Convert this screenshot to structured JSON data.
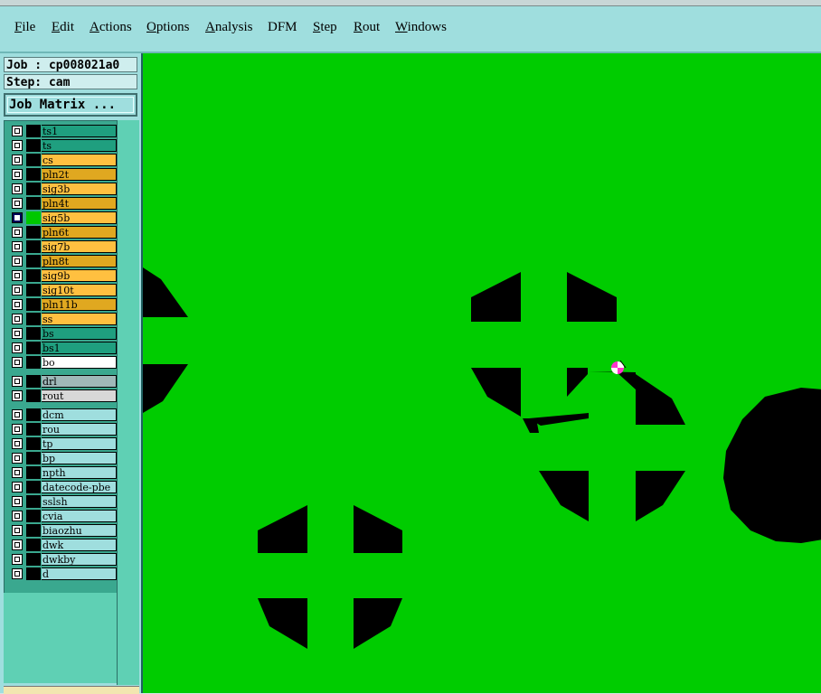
{
  "menu": [
    {
      "pre": "",
      "u": "F",
      "post": "ile"
    },
    {
      "pre": "",
      "u": "E",
      "post": "dit"
    },
    {
      "pre": "",
      "u": "A",
      "post": "ctions"
    },
    {
      "pre": "",
      "u": "O",
      "post": "ptions"
    },
    {
      "pre": "",
      "u": "A",
      "post": "nalysis"
    },
    {
      "pre": "DFM",
      "u": "",
      "post": ""
    },
    {
      "pre": "",
      "u": "S",
      "post": "tep"
    },
    {
      "pre": "",
      "u": "R",
      "post": "out"
    },
    {
      "pre": "",
      "u": "W",
      "post": "indows"
    }
  ],
  "info": {
    "job": "Job : cp008021a0",
    "step": "Step: cam",
    "job_matrix": "Job Matrix ..."
  },
  "layers": [
    {
      "name": "ts1",
      "color": "#1f9f7f"
    },
    {
      "name": "ts",
      "color": "#1f9f7f"
    },
    {
      "name": "cs",
      "color": "#ffc040"
    },
    {
      "name": "pln2t",
      "color": "#e0a820"
    },
    {
      "name": "sig3b",
      "color": "#ffc040"
    },
    {
      "name": "pln4t",
      "color": "#e0a820"
    },
    {
      "name": "sig5b",
      "color": "#ffc040",
      "active": true
    },
    {
      "name": "pln6t",
      "color": "#e0a820"
    },
    {
      "name": "sig7b",
      "color": "#ffc040"
    },
    {
      "name": "pln8t",
      "color": "#e0a820"
    },
    {
      "name": "sig9b",
      "color": "#ffc040"
    },
    {
      "name": "sig10t",
      "color": "#ffc040"
    },
    {
      "name": "pln11b",
      "color": "#e0a820"
    },
    {
      "name": "ss",
      "color": "#ffc040"
    },
    {
      "name": "bs",
      "color": "#1f9f7f"
    },
    {
      "name": "bs1",
      "color": "#1f9f7f"
    },
    {
      "name": "bo",
      "color": "#ffffff"
    },
    {
      "name": "drl",
      "color": "#9fb8b8"
    },
    {
      "name": "rout",
      "color": "#d8d8d8"
    },
    {
      "name": "dcm",
      "color": "#9fdede"
    },
    {
      "name": "rou",
      "color": "#9fdede"
    },
    {
      "name": "tp",
      "color": "#9fdede"
    },
    {
      "name": "bp",
      "color": "#9fdede"
    },
    {
      "name": "npth",
      "color": "#9fdede"
    },
    {
      "name": "datecode-pbe",
      "color": "#9fdede"
    },
    {
      "name": "sslsh",
      "color": "#9fdede"
    },
    {
      "name": "cvia",
      "color": "#9fdede"
    },
    {
      "name": "biaozhu",
      "color": "#9fdede"
    },
    {
      "name": "dwk",
      "color": "#9fdede"
    },
    {
      "name": "dwkby",
      "color": "#9fdede"
    },
    {
      "name": "d",
      "color": "#9fdede"
    }
  ],
  "colors": {
    "canvas_bg": "#00cc00",
    "feature": "#000000",
    "cursor": "#ff33cc"
  }
}
